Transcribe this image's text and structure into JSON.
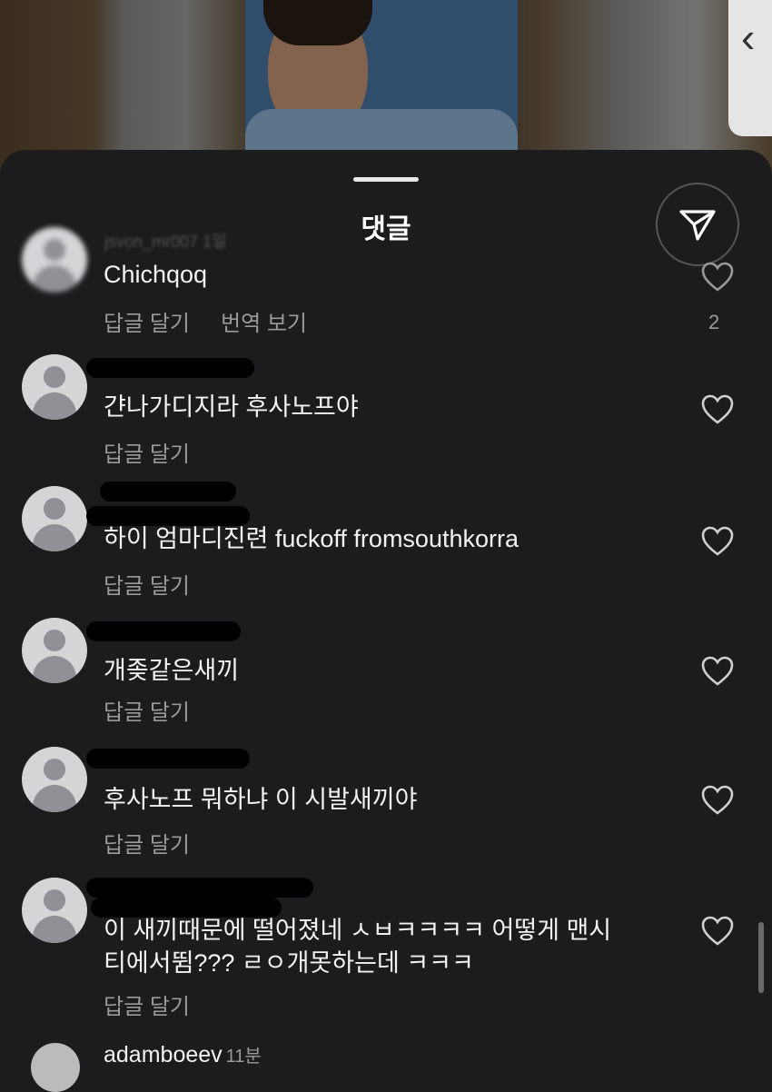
{
  "sheet": {
    "title": "댓글",
    "send_icon": "paper-plane-icon"
  },
  "comments": [
    {
      "username": "jsvon_mr007",
      "time": "1일",
      "text": "Chichqoq",
      "reply_label": "답글 달기",
      "translate_label": "번역 보기",
      "likes": "2"
    },
    {
      "text": "갼나가디지라 후사노프야",
      "reply_label": "답글 달기"
    },
    {
      "text": "하이 엄마디진련 fuckoff fromsouthkorra",
      "reply_label": "답글 달기"
    },
    {
      "text": "개좆같은새끼",
      "reply_label": "답글 달기"
    },
    {
      "text": "후사노프 뭐하냐 이 시발새끼야",
      "reply_label": "답글 달기"
    },
    {
      "text_line1": "이 새끼때문에 떨어졌네 ㅅㅂㅋㅋㅋㅋ 어떻게 맨시",
      "text_line2": "티에서뜀??? ㄹㅇ개못하는데 ㅋㅋㅋ",
      "reply_label": "답글 달기"
    }
  ],
  "last_comment": {
    "username": "adamboeev",
    "time": "11분"
  }
}
